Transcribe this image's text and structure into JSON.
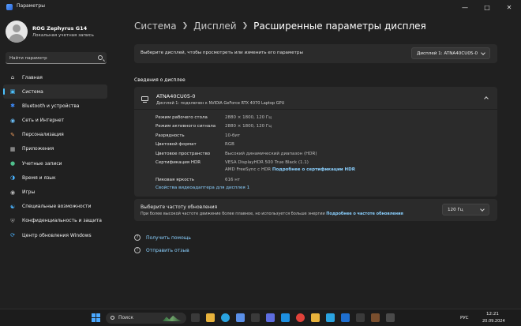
{
  "window": {
    "title": "Параметры"
  },
  "profile": {
    "name": "ROG Zephyrus G14",
    "account": "Локальная учетная запись"
  },
  "search": {
    "placeholder": "Найти параметр"
  },
  "nav": [
    {
      "label": "Главная",
      "icon": "home-icon"
    },
    {
      "label": "Система",
      "icon": "system-icon"
    },
    {
      "label": "Bluetooth и устройства",
      "icon": "bluetooth-icon"
    },
    {
      "label": "Сеть и Интернет",
      "icon": "wifi-icon"
    },
    {
      "label": "Персонализация",
      "icon": "brush-icon"
    },
    {
      "label": "Приложения",
      "icon": "apps-icon"
    },
    {
      "label": "Учетные записи",
      "icon": "user-icon"
    },
    {
      "label": "Время и язык",
      "icon": "globe-icon"
    },
    {
      "label": "Игры",
      "icon": "gamepad-icon"
    },
    {
      "label": "Специальные возможности",
      "icon": "accessibility-icon"
    },
    {
      "label": "Конфиденциальность и защита",
      "icon": "shield-icon"
    },
    {
      "label": "Центр обновления Windows",
      "icon": "update-icon"
    }
  ],
  "breadcrumb": {
    "crumb1": "Система",
    "crumb2": "Дисплей",
    "current": "Расширенные параметры дисплея"
  },
  "select_display": {
    "label": "Выберите дисплей, чтобы просмотреть или изменить его параметры",
    "value": "Дисплей 1: ATNA40CU05-0"
  },
  "info": {
    "section_title": "Сведения о дисплее",
    "monitor_name": "ATNA40CU05-0",
    "monitor_sub": "Дисплей 1: подключен к NVIDIA GeForce RTX 4070 Laptop GPU",
    "rows": [
      {
        "key": "Режим рабочего стола",
        "value": "2880 × 1800, 120 Гц"
      },
      {
        "key": "Режим активного сигнала",
        "value": "2880 × 1800, 120 Гц"
      },
      {
        "key": "Разрядность",
        "value": "10-бит"
      },
      {
        "key": "Цветовой формат",
        "value": "RGB"
      },
      {
        "key": "Цветовое пространство",
        "value": "Высокий динамический диапазон (HDR)"
      },
      {
        "key": "Сертификация HDR",
        "value": "VESA DisplayHDR 500 True Black (1.1)",
        "value2": "AMD FreeSync с HDR",
        "link": "Подробнее о сертификации HDR"
      },
      {
        "key": "Пиковая яркость",
        "value": "616 нт"
      }
    ],
    "adapter_link": "Свойства видеоадаптера для дисплея 1"
  },
  "refresh": {
    "title": "Выберите частоту обновления",
    "desc": "При более высокой частоте движение более плавное, но используется больше энергии",
    "link": "Подробнее о частоте обновления",
    "value": "120 Гц"
  },
  "help": {
    "get_help": "Получить помощь",
    "feedback": "Отправить отзыв"
  },
  "taskbar": {
    "search": "Поиск",
    "lang": "РУС",
    "time": "12:21",
    "date": "20.09.2024"
  }
}
